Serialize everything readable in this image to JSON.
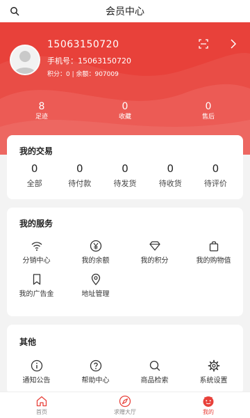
{
  "header": {
    "title": "会员中心",
    "search_icon": "search-icon"
  },
  "profile": {
    "username": "15063150720",
    "phone_label": "手机号：15063150720",
    "points_line": "积分：0 | 余额：907009",
    "actions": [
      "scan-icon",
      "chevron-right-icon"
    ]
  },
  "stats": [
    {
      "value": "8",
      "label": "足迹"
    },
    {
      "value": "0",
      "label": "收藏"
    },
    {
      "value": "0",
      "label": "售后"
    }
  ],
  "trade": {
    "title": "我的交易",
    "items": [
      {
        "count": "0",
        "label": "全部"
      },
      {
        "count": "0",
        "label": "待付款"
      },
      {
        "count": "0",
        "label": "待发货"
      },
      {
        "count": "0",
        "label": "待收货"
      },
      {
        "count": "0",
        "label": "待评价"
      }
    ]
  },
  "services": {
    "title": "我的服务",
    "items": [
      {
        "label": "分销中心",
        "icon": "wifi-icon"
      },
      {
        "label": "我的余额",
        "icon": "yen-icon"
      },
      {
        "label": "我的积分",
        "icon": "diamond-icon"
      },
      {
        "label": "我的购物值",
        "icon": "bag-icon"
      },
      {
        "label": "我的广告金",
        "icon": "bookmark-icon"
      },
      {
        "label": "地址管理",
        "icon": "location-icon"
      }
    ]
  },
  "others": {
    "title": "其他",
    "items": [
      {
        "label": "通知公告",
        "icon": "info-icon"
      },
      {
        "label": "帮助中心",
        "icon": "help-icon"
      },
      {
        "label": "商品检索",
        "icon": "search-icon"
      },
      {
        "label": "系统设置",
        "icon": "gear-icon"
      }
    ]
  },
  "tabbar": {
    "items": [
      {
        "label": "首页",
        "icon": "home-icon",
        "active": false
      },
      {
        "label": "求赠大厅",
        "icon": "compass-icon",
        "active": false
      },
      {
        "label": "我的",
        "icon": "user-face-icon",
        "active": true
      }
    ]
  },
  "colors": {
    "accent": "#e8413a",
    "background": "#f3f3f3",
    "card": "#ffffff"
  }
}
